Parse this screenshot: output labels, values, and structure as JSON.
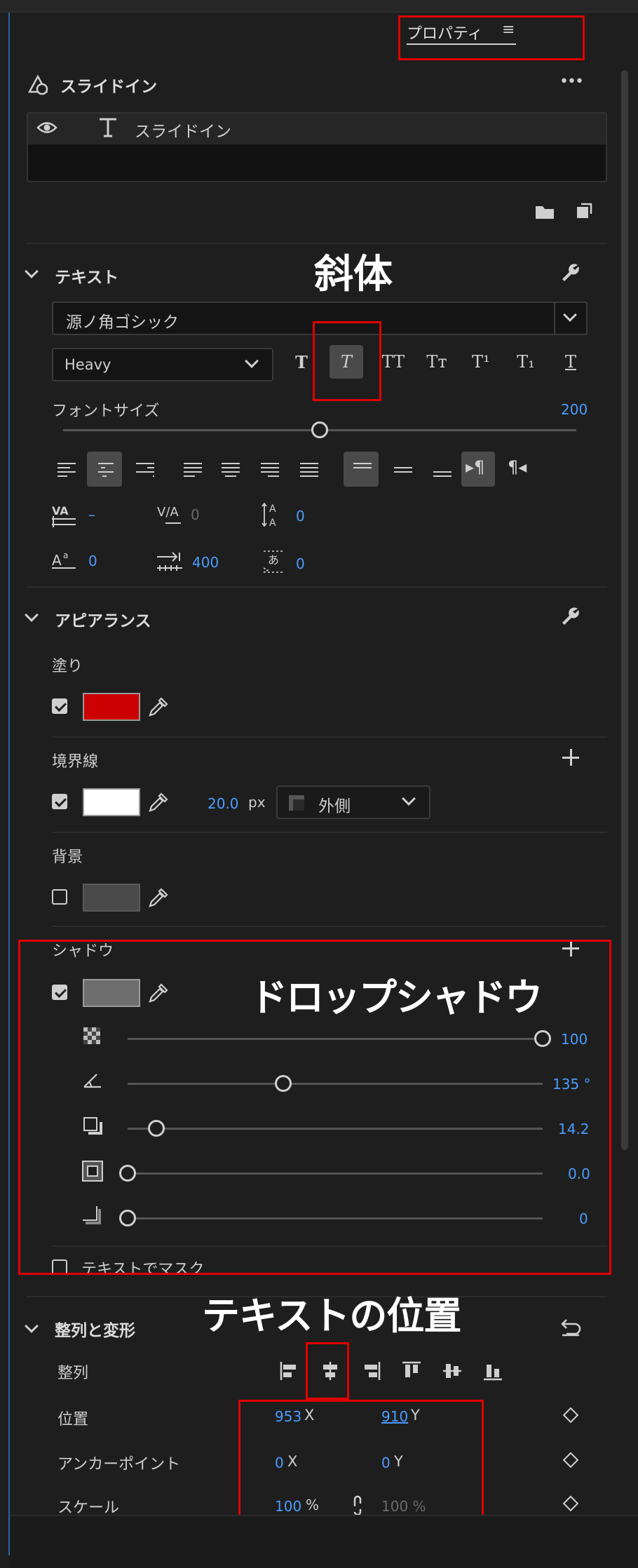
{
  "panel": {
    "tab_title": "プロパティ",
    "menu_glyph": "≡",
    "layer_title": "スライドイン",
    "more_glyph": "•••",
    "layer_row_label": "スライドイン"
  },
  "text_section": {
    "title": "テキスト",
    "font_family": "源ノ角ゴシック",
    "font_weight": "Heavy",
    "style_buttons": [
      "T",
      "T",
      "TT",
      "Tт",
      "T¹",
      "T₁",
      "T"
    ],
    "font_size_label": "フォントサイズ",
    "font_size_value": "200",
    "font_size_fraction": 0.5,
    "kerning_value": "–",
    "tracking_value": "0",
    "leading_value": "0",
    "baseline_value": "0",
    "tab_width_value": "400",
    "tsume_value": "0"
  },
  "appearance": {
    "title": "アピアランス",
    "fill_label": "塗り",
    "fill_color": "#cc0000",
    "stroke_label": "境界線",
    "stroke_color": "#ffffff",
    "stroke_width": "20.0",
    "stroke_unit": "px",
    "stroke_position": "外側",
    "background_label": "背景",
    "background_color": "#4a4a4a",
    "shadow_label": "シャドウ",
    "shadow_color": "#6e6e6e",
    "shadow_opacity": "100",
    "shadow_opacity_fraction": 1.0,
    "shadow_angle": "135 °",
    "shadow_angle_fraction": 0.375,
    "shadow_distance": "14.2",
    "shadow_distance_fraction": 0.07,
    "shadow_size": "0.0",
    "shadow_size_fraction": 0.0,
    "shadow_blur": "0",
    "shadow_blur_fraction": 0.0,
    "mask_label": "テキストでマスク"
  },
  "transform": {
    "title": "整列と変形",
    "align_label": "整列",
    "position_label": "位置",
    "position_x": "953",
    "position_y": "910",
    "anchor_label": "アンカーポイント",
    "anchor_x": "0",
    "anchor_y": "0",
    "scale_label": "スケール",
    "scale_value": "100",
    "scale_unit": "%",
    "scale_linked": "100 %",
    "x_label": "X",
    "y_label": "Y"
  },
  "annotations": {
    "italic": "斜体",
    "drop_shadow": "ドロップシャドウ",
    "text_position": "テキストの位置"
  },
  "colors": {
    "accent_blue": "#4a9cff",
    "annotation_red": "#e00000"
  }
}
